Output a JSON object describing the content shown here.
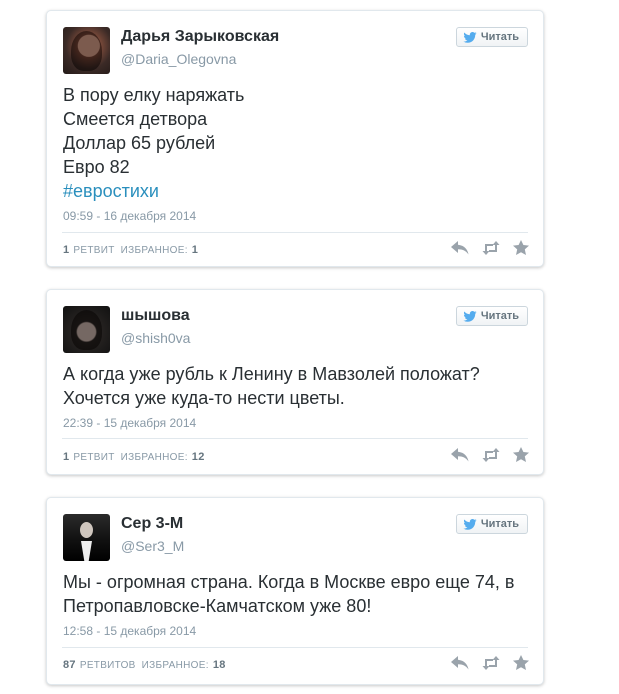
{
  "follow_label": "Читать",
  "tweets": [
    {
      "name": "Дарья Зарыковская",
      "handle": "@Daria_Olegovna",
      "lines": [
        "В пору елку наряжать",
        "Смеется детвора",
        "Доллар 65 рублей",
        "Евро 82"
      ],
      "hashtag": "#евростихи",
      "date": "09:59 - 16 декабря 2014",
      "retweets_count": "1",
      "retweets_label": "РЕТВИТ",
      "favorites_label": "ИЗБРАННОЕ:",
      "favorites_count": "1"
    },
    {
      "name": "шышова",
      "handle": "@shish0va",
      "lines": [
        "А когда уже рубль к Ленину в Мавзолей положат?",
        "Хочется уже куда-то нести цветы."
      ],
      "date": "22:39 - 15 декабря 2014",
      "retweets_count": "1",
      "retweets_label": "РЕТВИТ",
      "favorites_label": "ИЗБРАННОЕ:",
      "favorites_count": "12"
    },
    {
      "name": "Сер 3-М",
      "handle": "@Ser3_M",
      "lines": [
        "Мы - огромная страна. Когда в Москве евро еще 74, в",
        "Петропавловске-Камчатском уже 80!"
      ],
      "date": "12:58 - 15 декабря 2014",
      "retweets_count": "87",
      "retweets_label": "РЕТВИТОВ",
      "favorites_label": "ИЗБРАННОЕ:",
      "favorites_count": "18"
    }
  ],
  "colors": {
    "text": "#292f33",
    "muted": "#8899a6",
    "hashtag": "#2a8fbd",
    "twitter_blue": "#55acee",
    "action_icon": "#9aa3ab"
  },
  "icons": [
    "twitter-bird-icon",
    "reply-icon",
    "retweet-icon",
    "favorite-star-icon"
  ]
}
